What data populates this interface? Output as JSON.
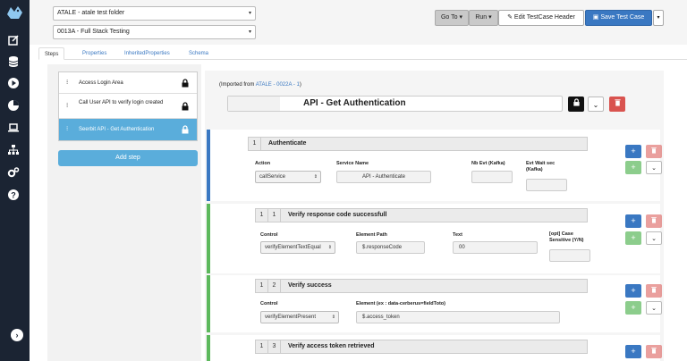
{
  "topbar": {
    "folder_select": "ATALE - atale test folder",
    "testcase_select": "0013A - Full Stack Testing",
    "goto_label": "Go To ▾",
    "run_label": "Run ▾",
    "edit_header_label": "Edit TestCase Header",
    "save_label": "Save Test Case"
  },
  "tabs": [
    "Steps",
    "Properties",
    "InheritedProperties",
    "Schema"
  ],
  "steps": [
    {
      "label": "Access Login Area"
    },
    {
      "label": "Call User API to verify login created"
    },
    {
      "label": "Seerbit API - Get Authentication"
    }
  ],
  "add_step_label": "Add step",
  "step_detail": {
    "imported_prefix": "(Imported from ",
    "imported_link": "ATALE - 0022A - 1",
    "imported_suffix": ")",
    "title": "API - Get Authentication"
  },
  "action1": {
    "num": "1",
    "title": "Authenticate",
    "labels": {
      "action": "Action",
      "service": "Service Name",
      "nb_evt": "Nb Evt (Kafka)",
      "evt_wait": "Evt Wait sec (Kafka)"
    },
    "action_value": "callService",
    "service_value": "API - Authenticate"
  },
  "control1": {
    "num1": "1",
    "num2": "1",
    "title": "Verify response code successfull",
    "labels": {
      "control": "Control",
      "path": "Element Path",
      "text": "Text",
      "case": "[opt] Case Sensitive (Y/N)"
    },
    "control_value": "verifyElementTextEqual",
    "path_value": "$.responseCode",
    "text_value": "00"
  },
  "control2": {
    "num1": "1",
    "num2": "2",
    "title": "Verify success",
    "labels": {
      "control": "Control",
      "element": "Element (ex : data-cerberus=fieldToto)"
    },
    "control_value": "verifyElementPresent",
    "element_value": "$.access_token"
  },
  "control3": {
    "num1": "1",
    "num2": "3",
    "title": "Verify access token retrieved"
  },
  "colors": {
    "nav_bg": "#1b2433",
    "accent_blue": "#3a78c2",
    "step_active": "#5aaddb",
    "action_bar": "#3a78c2",
    "control_bar": "#5cb85c"
  }
}
